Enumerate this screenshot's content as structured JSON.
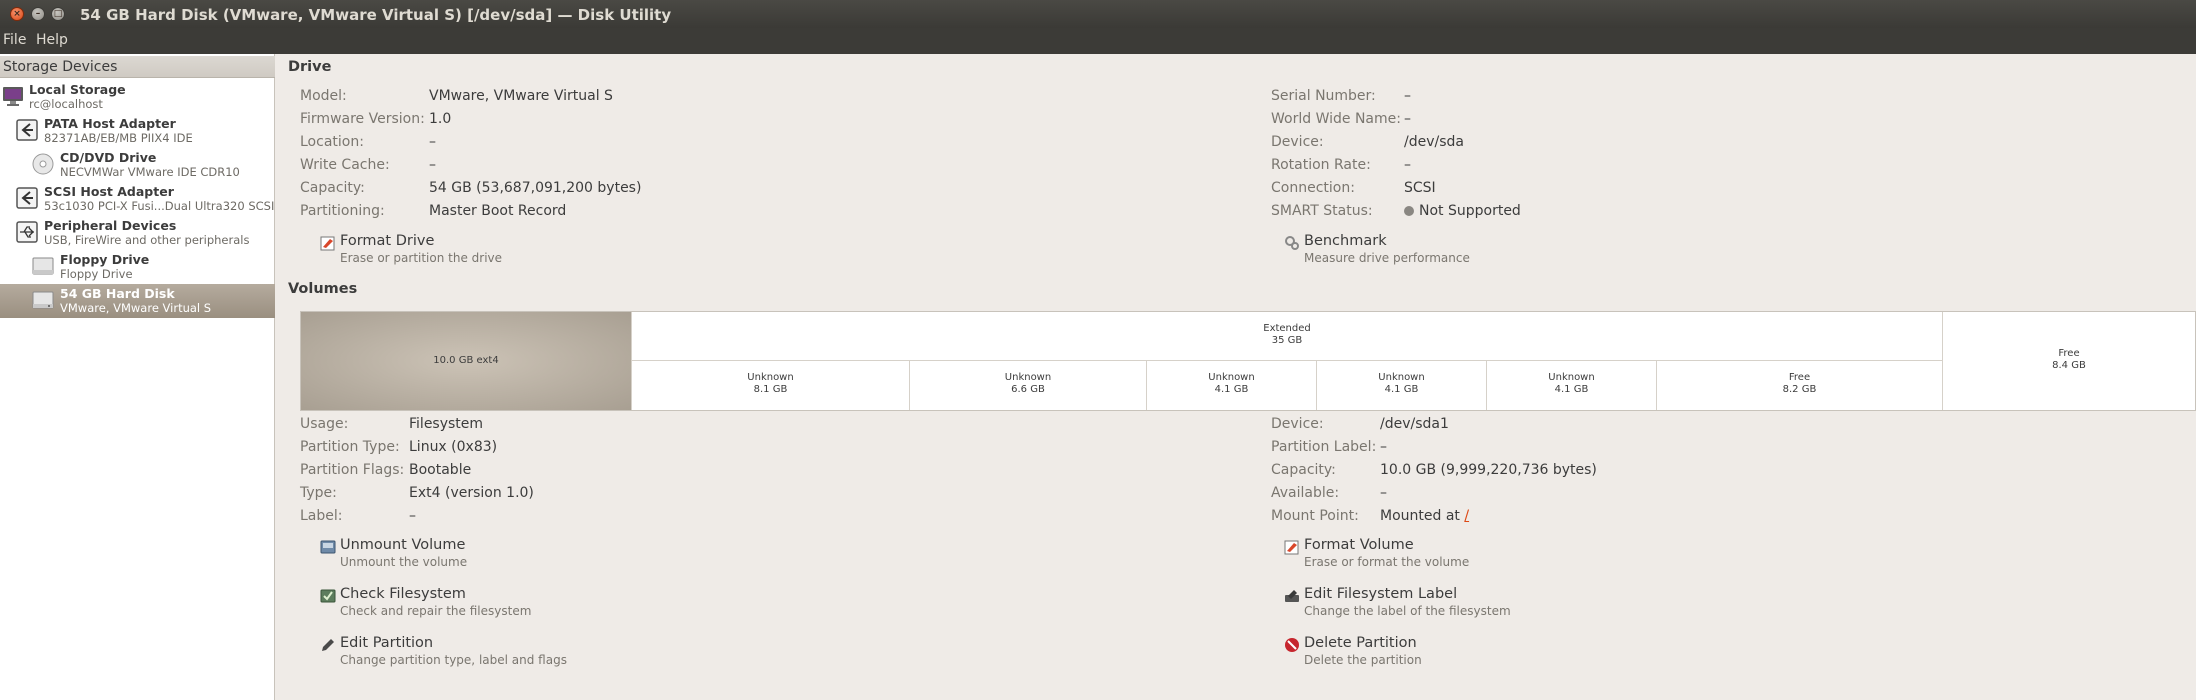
{
  "window": {
    "title": "54 GB Hard Disk (VMware, VMware Virtual S) [/dev/sda] — Disk Utility",
    "close_glyph": "×",
    "min_glyph": "–",
    "max_glyph": "□"
  },
  "menubar": {
    "file": "File",
    "help": "Help"
  },
  "sidebar": {
    "header": "Storage Devices",
    "devices": [
      {
        "name": "Local Storage",
        "sub": "rc@localhost",
        "icon": "computer-icon"
      },
      {
        "name": "PATA Host Adapter",
        "sub": "82371AB/EB/MB PIIX4 IDE",
        "icon": "host-adapter-icon"
      },
      {
        "name": "CD/DVD Drive",
        "sub": "NECVMWar VMware IDE CDR10",
        "icon": "cdrom-icon"
      },
      {
        "name": "SCSI Host Adapter",
        "sub": "53c1030 PCI-X Fusi...Dual Ultra320 SCSI",
        "icon": "host-adapter-icon"
      },
      {
        "name": "Peripheral Devices",
        "sub": "USB, FireWire and other peripherals",
        "icon": "usb-icon"
      },
      {
        "name": "Floppy Drive",
        "sub": "Floppy Drive",
        "icon": "floppy-icon"
      },
      {
        "name": "54 GB Hard Disk",
        "sub": "VMware, VMware Virtual S",
        "icon": "harddisk-icon",
        "selected": true
      }
    ]
  },
  "drive": {
    "title": "Drive",
    "left": [
      {
        "label": "Model:",
        "value": "VMware, VMware Virtual S"
      },
      {
        "label": "Firmware Version:",
        "value": "1.0"
      },
      {
        "label": "Location:",
        "value": "–"
      },
      {
        "label": "Write Cache:",
        "value": "–"
      },
      {
        "label": "Capacity:",
        "value": "54 GB (53,687,091,200 bytes)"
      },
      {
        "label": "Partitioning:",
        "value": "Master Boot Record"
      }
    ],
    "right": [
      {
        "label": "Serial Number:",
        "value": "–"
      },
      {
        "label": "World Wide Name:",
        "value": "–"
      },
      {
        "label": "Device:",
        "value": "/dev/sda"
      },
      {
        "label": "Rotation Rate:",
        "value": "–"
      },
      {
        "label": "Connection:",
        "value": "SCSI"
      },
      {
        "label": "SMART Status:",
        "value": "Not Supported"
      }
    ],
    "actions": {
      "format": {
        "label": "Format Drive",
        "desc": "Erase or partition the drive"
      },
      "benchmark": {
        "label": "Benchmark",
        "desc": "Measure drive performance"
      }
    }
  },
  "volumes": {
    "title": "Volumes",
    "map": {
      "first": {
        "label": "10.0 GB ext4"
      },
      "extended": {
        "name": "Extended",
        "size": "35 GB"
      },
      "logical": [
        {
          "name": "Unknown",
          "size": "8.1 GB"
        },
        {
          "name": "Unknown",
          "size": "6.6 GB"
        },
        {
          "name": "Unknown",
          "size": "4.1 GB"
        },
        {
          "name": "Unknown",
          "size": "4.1 GB"
        },
        {
          "name": "Unknown",
          "size": "4.1 GB"
        },
        {
          "name": "Free",
          "size": "8.2 GB"
        }
      ],
      "free": {
        "name": "Free",
        "size": "8.4 GB"
      }
    },
    "left": [
      {
        "label": "Usage:",
        "value": "Filesystem"
      },
      {
        "label": "Partition Type:",
        "value": "Linux (0x83)"
      },
      {
        "label": "Partition Flags:",
        "value": "Bootable"
      },
      {
        "label": "Type:",
        "value": "Ext4 (version 1.0)"
      },
      {
        "label": "Label:",
        "value": "–"
      }
    ],
    "right": [
      {
        "label": "Device:",
        "value": "/dev/sda1"
      },
      {
        "label": "Partition Label:",
        "value": "–"
      },
      {
        "label": "Capacity:",
        "value": "10.0 GB (9,999,220,736 bytes)"
      },
      {
        "label": "Available:",
        "value": "–"
      },
      {
        "label": "Mount Point:",
        "value": "Mounted at",
        "link": "/"
      }
    ],
    "actions": {
      "unmount": {
        "label": "Unmount Volume",
        "desc": "Unmount the volume"
      },
      "check": {
        "label": "Check Filesystem",
        "desc": "Check and repair the filesystem"
      },
      "edit_partition": {
        "label": "Edit Partition",
        "desc": "Change partition type, label and flags"
      },
      "format_volume": {
        "label": "Format Volume",
        "desc": "Erase or format the volume"
      },
      "edit_label": {
        "label": "Edit Filesystem Label",
        "desc": "Change the label of the filesystem"
      },
      "delete": {
        "label": "Delete Partition",
        "desc": "Delete the partition"
      }
    }
  },
  "colors": {
    "accent": "#dd4814",
    "selected": "#a89f92",
    "titlebar": "#3c3b37"
  }
}
